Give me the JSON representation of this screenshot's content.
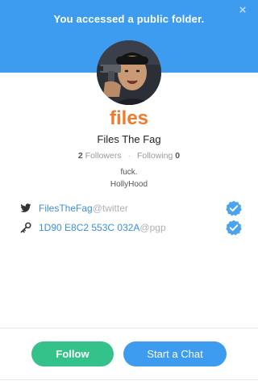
{
  "banner": {
    "message": "You accessed a public folder.",
    "close_glyph": "×"
  },
  "profile": {
    "display_name": "files",
    "full_name": "Files The Fag",
    "followers_count": "2",
    "followers_label": "Followers",
    "following_label": "Following",
    "following_count": "0",
    "separator": "·",
    "bio_line1": "fuck.",
    "bio_line2": "HollyHood",
    "avatar_icon": "user-photo"
  },
  "accounts": [
    {
      "handle": "FilesTheFag",
      "service": "@twitter",
      "icon": "twitter-bird-icon",
      "verified": true
    },
    {
      "handle": "1D90 E8C2 553C 032A",
      "service": "@pgp",
      "icon": "key-icon",
      "verified": true
    }
  ],
  "actions": {
    "follow_label": "Follow",
    "chat_label": "Start a Chat"
  },
  "colors": {
    "banner": "#3d9cf0",
    "name_accent": "#f27a2a",
    "follow_button": "#34c28a",
    "chat_button": "#3d9cf0",
    "link": "#3d8fd9"
  }
}
